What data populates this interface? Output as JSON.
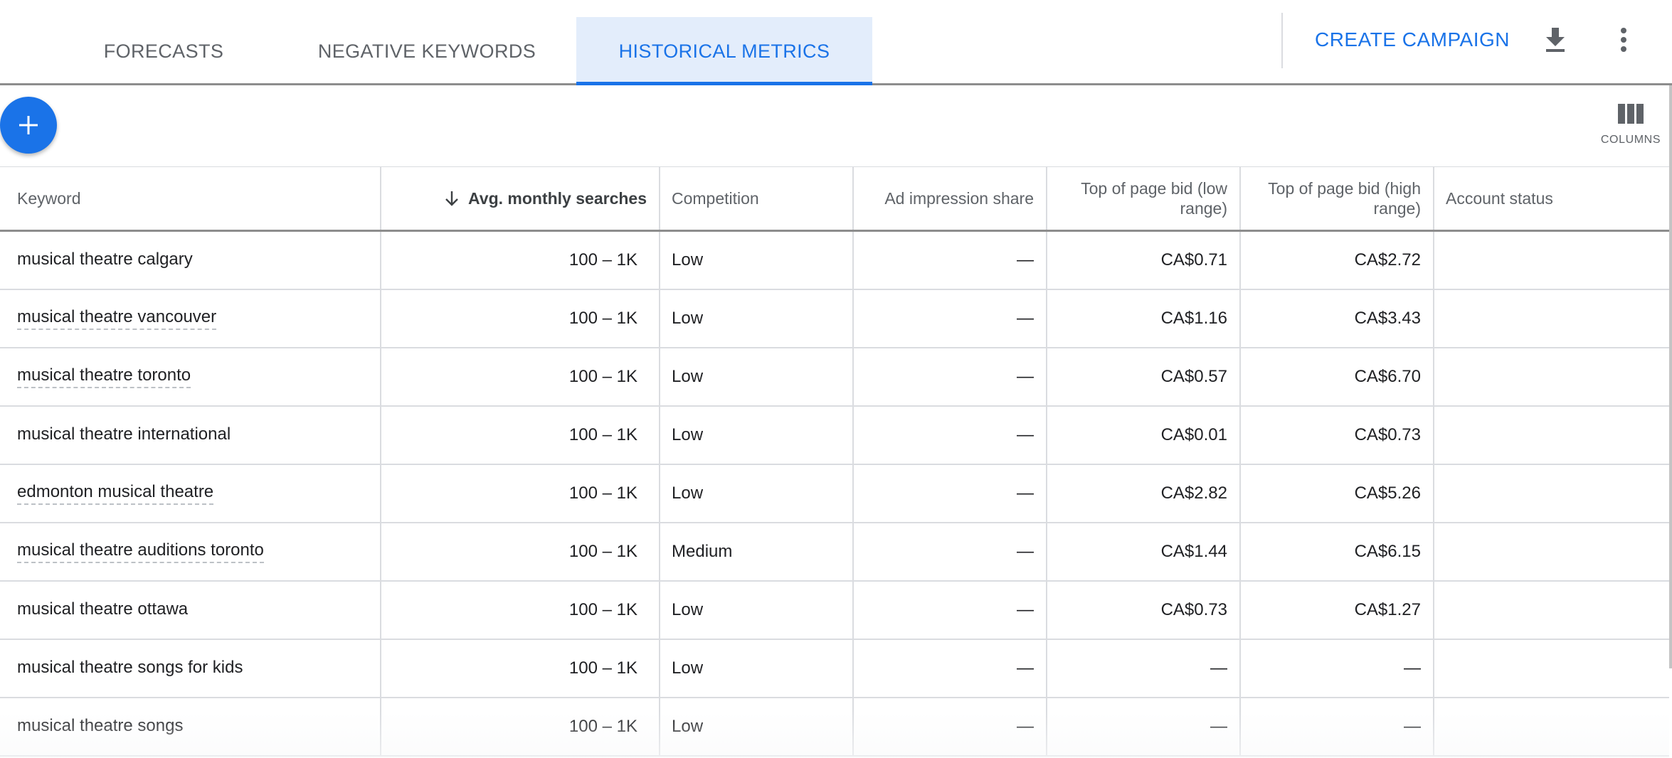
{
  "tabs": [
    {
      "label": "FORECASTS",
      "active": false
    },
    {
      "label": "NEGATIVE KEYWORDS",
      "active": false
    },
    {
      "label": "HISTORICAL METRICS",
      "active": true
    }
  ],
  "actions": {
    "create_campaign": "CREATE CAMPAIGN",
    "download_icon": "download-icon",
    "more_icon": "more-vert-icon"
  },
  "toolbar": {
    "add_icon": "plus-icon",
    "columns_label": "COLUMNS"
  },
  "colors": {
    "accent": "#1a73e8",
    "active_tab_bg": "#e3edfb",
    "text": "#202124",
    "muted": "#5f6368"
  },
  "table": {
    "sort": {
      "column": "Avg. monthly searches",
      "direction": "descending"
    },
    "headers": {
      "keyword": "Keyword",
      "avg_monthly_searches": "Avg. monthly searches",
      "competition": "Competition",
      "ad_impression_share": "Ad impression share",
      "bid_low": "Top of page bid (low range)",
      "bid_high": "Top of page bid (high range)",
      "account_status": "Account status"
    },
    "rows": [
      {
        "keyword": "musical theatre calgary",
        "avg_monthly_searches": "100 – 1K",
        "competition": "Low",
        "ad_impression_share": "—",
        "bid_low": "CA$0.71",
        "bid_high": "CA$2.72",
        "account_status": "",
        "underlined": false
      },
      {
        "keyword": "musical theatre vancouver",
        "avg_monthly_searches": "100 – 1K",
        "competition": "Low",
        "ad_impression_share": "—",
        "bid_low": "CA$1.16",
        "bid_high": "CA$3.43",
        "account_status": "",
        "underlined": true
      },
      {
        "keyword": "musical theatre toronto",
        "avg_monthly_searches": "100 – 1K",
        "competition": "Low",
        "ad_impression_share": "—",
        "bid_low": "CA$0.57",
        "bid_high": "CA$6.70",
        "account_status": "",
        "underlined": true
      },
      {
        "keyword": "musical theatre international",
        "avg_monthly_searches": "100 – 1K",
        "competition": "Low",
        "ad_impression_share": "—",
        "bid_low": "CA$0.01",
        "bid_high": "CA$0.73",
        "account_status": "",
        "underlined": false
      },
      {
        "keyword": "edmonton musical theatre",
        "avg_monthly_searches": "100 – 1K",
        "competition": "Low",
        "ad_impression_share": "—",
        "bid_low": "CA$2.82",
        "bid_high": "CA$5.26",
        "account_status": "",
        "underlined": true
      },
      {
        "keyword": "musical theatre auditions toronto",
        "avg_monthly_searches": "100 – 1K",
        "competition": "Medium",
        "ad_impression_share": "—",
        "bid_low": "CA$1.44",
        "bid_high": "CA$6.15",
        "account_status": "",
        "underlined": true
      },
      {
        "keyword": "musical theatre ottawa",
        "avg_monthly_searches": "100 – 1K",
        "competition": "Low",
        "ad_impression_share": "—",
        "bid_low": "CA$0.73",
        "bid_high": "CA$1.27",
        "account_status": "",
        "underlined": false
      },
      {
        "keyword": "musical theatre songs for kids",
        "avg_monthly_searches": "100 – 1K",
        "competition": "Low",
        "ad_impression_share": "—",
        "bid_low": "—",
        "bid_high": "—",
        "account_status": "",
        "underlined": false
      },
      {
        "keyword": "musical theatre songs",
        "avg_monthly_searches": "100 – 1K",
        "competition": "Low",
        "ad_impression_share": "—",
        "bid_low": "—",
        "bid_high": "—",
        "account_status": "",
        "underlined": false
      }
    ]
  }
}
